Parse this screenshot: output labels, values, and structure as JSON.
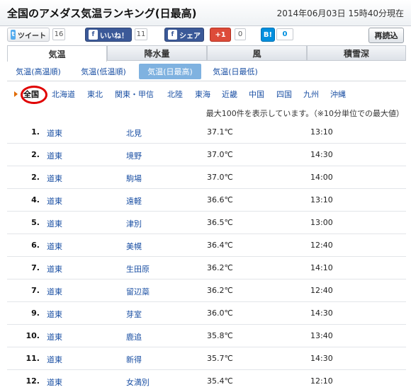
{
  "header": {
    "title": "全国のアメダス気温ランキング(日最高)",
    "timestamp": "2014年06月03日 15時40分現在"
  },
  "social": {
    "tweet_label": "ツイート",
    "tweet_count": "16",
    "like_label": "いいね！",
    "like_count": "11",
    "share_label": "シェア",
    "gplus_label": "+1",
    "gplus_count": "0",
    "hatena_label": "B!",
    "hatena_count": "0",
    "reload_label": "再読込"
  },
  "main_tabs": [
    {
      "label": "気温",
      "active": true
    },
    {
      "label": "降水量",
      "active": false
    },
    {
      "label": "風",
      "active": false
    },
    {
      "label": "積雪深",
      "active": false
    }
  ],
  "sub_tabs": [
    {
      "label": "気温(高温順)",
      "active": false
    },
    {
      "label": "気温(低温順)",
      "active": false
    },
    {
      "label": "気温(日最高)",
      "active": true
    },
    {
      "label": "気温(日最低)",
      "active": false
    }
  ],
  "regions": [
    {
      "label": "全国",
      "active": true
    },
    {
      "label": "北海道",
      "active": false
    },
    {
      "label": "東北",
      "active": false
    },
    {
      "label": "関東・甲信",
      "active": false
    },
    {
      "label": "北陸",
      "active": false
    },
    {
      "label": "東海",
      "active": false
    },
    {
      "label": "近畿",
      "active": false
    },
    {
      "label": "中国",
      "active": false
    },
    {
      "label": "四国",
      "active": false
    },
    {
      "label": "九州",
      "active": false
    },
    {
      "label": "沖縄",
      "active": false
    }
  ],
  "note": "最大100件を表示しています。（※10分単位での最大値）",
  "rankings": [
    {
      "rank": "1.",
      "region": "道東",
      "station": "北見",
      "temp": "37.1℃",
      "time": "13:10"
    },
    {
      "rank": "2.",
      "region": "道東",
      "station": "境野",
      "temp": "37.0℃",
      "time": "14:30"
    },
    {
      "rank": "2.",
      "region": "道東",
      "station": "駒場",
      "temp": "37.0℃",
      "time": "14:00"
    },
    {
      "rank": "4.",
      "region": "道東",
      "station": "遠軽",
      "temp": "36.6℃",
      "time": "13:10"
    },
    {
      "rank": "5.",
      "region": "道東",
      "station": "津別",
      "temp": "36.5℃",
      "time": "13:00"
    },
    {
      "rank": "6.",
      "region": "道東",
      "station": "美幌",
      "temp": "36.4℃",
      "time": "12:40"
    },
    {
      "rank": "7.",
      "region": "道東",
      "station": "生田原",
      "temp": "36.2℃",
      "time": "14:10"
    },
    {
      "rank": "7.",
      "region": "道東",
      "station": "留辺蘂",
      "temp": "36.2℃",
      "time": "12:40"
    },
    {
      "rank": "9.",
      "region": "道東",
      "station": "芽室",
      "temp": "36.0℃",
      "time": "14:30"
    },
    {
      "rank": "10.",
      "region": "道東",
      "station": "鹿追",
      "temp": "35.8℃",
      "time": "13:40"
    },
    {
      "rank": "11.",
      "region": "道東",
      "station": "新得",
      "temp": "35.7℃",
      "time": "14:30"
    },
    {
      "rank": "12.",
      "region": "道東",
      "station": "女満別",
      "temp": "35.4℃",
      "time": "12:10"
    }
  ],
  "colors": {
    "link": "#1a4fa3",
    "active_subtab": "#7fb2e0",
    "highlight_circle": "#e00000",
    "facebook": "#3b5998",
    "gplus": "#dd4b39",
    "hatena": "#008fde"
  }
}
